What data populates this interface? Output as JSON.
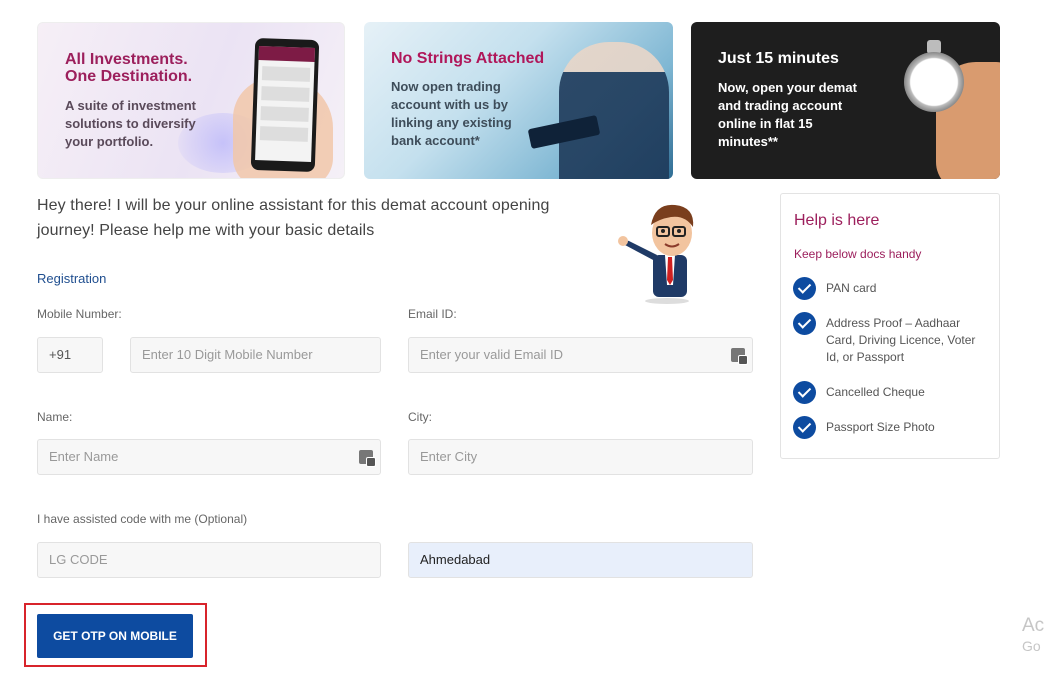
{
  "banners": [
    {
      "title_line1": "All Investments.",
      "title_line2": "One Destination.",
      "text": "A suite of investment solutions to diversify your portfolio."
    },
    {
      "title": "No Strings Attached",
      "text": "Now open trading account with us by linking any existing bank account*"
    },
    {
      "title": "Just 15 minutes",
      "text": "Now, open your demat and trading account online in flat 15 minutes**"
    }
  ],
  "intro": "Hey there! I will be your online assistant for this demat account opening journey! Please help me with your basic details",
  "registration_link": "Registration",
  "form": {
    "mobile_label": "Mobile Number:",
    "country_code": "+91",
    "mobile_placeholder": "Enter 10 Digit Mobile Number",
    "email_label": "Email ID:",
    "email_placeholder": "Enter your valid Email ID",
    "name_label": "Name:",
    "name_placeholder": "Enter Name",
    "city_label": "City:",
    "city_placeholder": "Enter City",
    "assisted_label": "I have assisted code with me (Optional)",
    "lg_placeholder": "LG CODE",
    "autofill_value": "Ahmedabad",
    "submit_label": "GET OTP ON MOBILE"
  },
  "help": {
    "title": "Help is here",
    "subtitle": "Keep below docs handy",
    "docs": [
      "PAN card",
      "Address Proof – Aadhaar Card, Driving Licence, Voter Id, or Passport",
      "Cancelled Cheque",
      "Passport Size Photo"
    ]
  },
  "watermark": {
    "line1": "Ac",
    "line2": "Go"
  },
  "colors": {
    "brand": "#9c1f5c",
    "primary": "#0d4ba0",
    "highlight": "#d8242b"
  }
}
